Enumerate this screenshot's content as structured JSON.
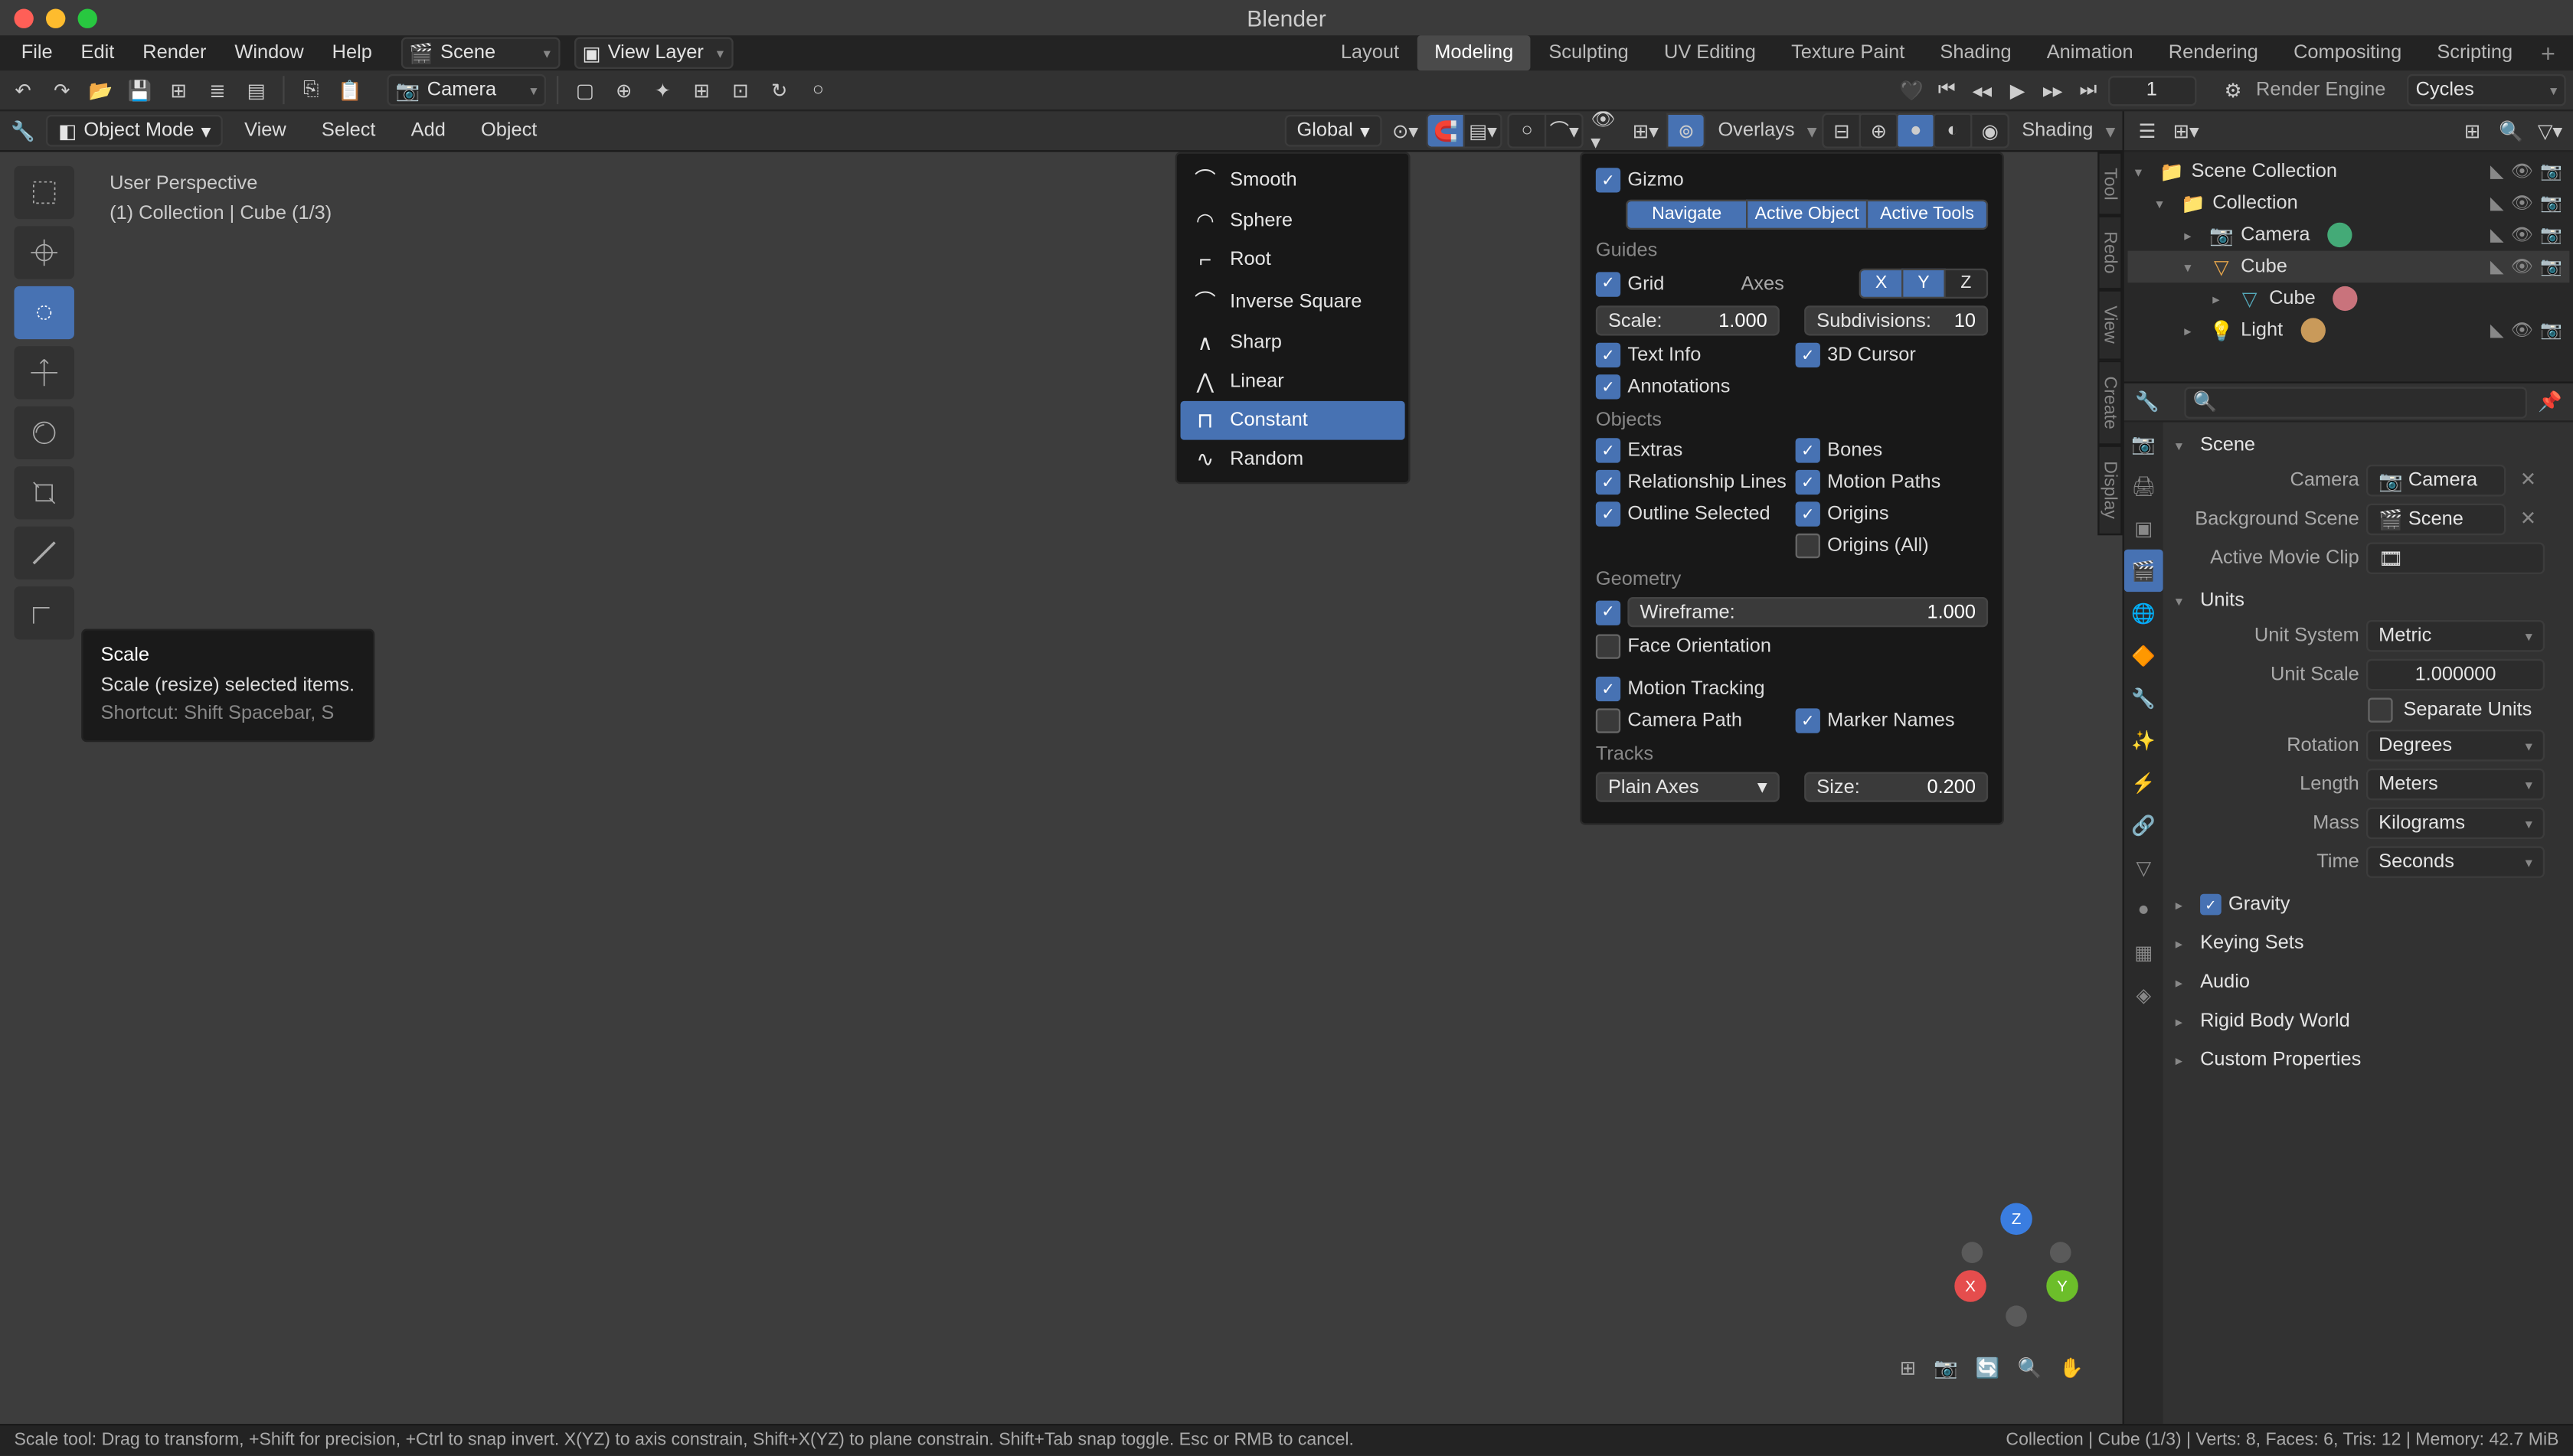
{
  "title": "Blender",
  "menus": [
    "File",
    "Edit",
    "Render",
    "Window",
    "Help"
  ],
  "scene_selector": "Scene",
  "view_layer_selector": "View Layer",
  "workspaces": [
    "Layout",
    "Modeling",
    "Sculpting",
    "UV Editing",
    "Texture Paint",
    "Shading",
    "Animation",
    "Rendering",
    "Compositing",
    "Scripting"
  ],
  "active_workspace": "Modeling",
  "camera_dropdown": "Camera",
  "frame": "1",
  "render_engine_label": "Render Engine",
  "render_engine_value": "Cycles",
  "viewport_header": {
    "mode": "Object Mode",
    "menus": [
      "View",
      "Select",
      "Add",
      "Object"
    ],
    "orientation": "Global",
    "overlays": "Overlays",
    "shading_label": "Shading"
  },
  "overlay_text": {
    "line1": "User Perspective",
    "line2": "(1) Collection | Cube (1/3)"
  },
  "falloff_menu": [
    "Smooth",
    "Sphere",
    "Root",
    "Inverse Square",
    "Sharp",
    "Linear",
    "Constant",
    "Random"
  ],
  "falloff_selected": "Constant",
  "overlays_panel": {
    "gizmo": "Gizmo",
    "navigate": "Navigate",
    "active_object": "Active Object",
    "active_tools": "Active Tools",
    "guides": "Guides",
    "grid": "Grid",
    "axes": "Axes",
    "scale_label": "Scale:",
    "scale": "1.000",
    "subdivisions_label": "Subdivisions:",
    "subdivisions": "10",
    "text_info": "Text Info",
    "cursor_3d": "3D Cursor",
    "annotations": "Annotations",
    "objects": "Objects",
    "extras": "Extras",
    "bones": "Bones",
    "relationship": "Relationship Lines",
    "motion_paths": "Motion Paths",
    "outline_selected": "Outline Selected",
    "origins": "Origins",
    "origins_all": "Origins (All)",
    "geometry": "Geometry",
    "wireframe_label": "Wireframe:",
    "wireframe": "1.000",
    "face_orientation": "Face Orientation",
    "motion_tracking": "Motion Tracking",
    "camera_path": "Camera Path",
    "marker_names": "Marker Names",
    "tracks": "Tracks",
    "tracks_display": "Plain Axes",
    "size_label": "Size:",
    "size": "0.200"
  },
  "tooltip": {
    "title": "Scale",
    "desc": "Scale (resize) selected items.",
    "shortcut": "Shortcut: Shift Spacebar, S"
  },
  "side_tabs": [
    "Tool",
    "Redo",
    "View",
    "Create",
    "Display"
  ],
  "outliner": {
    "root": "Scene Collection",
    "collection": "Collection",
    "items": [
      "Camera",
      "Cube",
      "Cube",
      "Light"
    ]
  },
  "properties": {
    "scene_panel": "Scene",
    "camera_label": "Camera",
    "camera_value": "Camera",
    "bg_scene_label": "Background Scene",
    "bg_scene_value": "Scene",
    "active_clip_label": "Active Movie Clip",
    "units_panel": "Units",
    "unit_system_label": "Unit System",
    "unit_system": "Metric",
    "unit_scale_label": "Unit Scale",
    "unit_scale": "1.000000",
    "separate_units": "Separate Units",
    "rotation_label": "Rotation",
    "rotation": "Degrees",
    "length_label": "Length",
    "length": "Meters",
    "mass_label": "Mass",
    "mass": "Kilograms",
    "time_label": "Time",
    "time": "Seconds",
    "gravity_panel": "Gravity",
    "keying_panel": "Keying Sets",
    "audio_panel": "Audio",
    "rigidbody_panel": "Rigid Body World",
    "custom_panel": "Custom Properties"
  },
  "statusbar": {
    "hints": "Scale tool: Drag to transform, +Shift for precision, +Ctrl to snap invert. X(YZ) to axis constrain, Shift+X(YZ) to plane constrain. Shift+Tab snap toggle. Esc or RMB to cancel.",
    "stats": "Collection | Cube (1/3) | Verts: 8, Faces: 6, Tris: 12 | Memory: 42.7 MiB"
  }
}
